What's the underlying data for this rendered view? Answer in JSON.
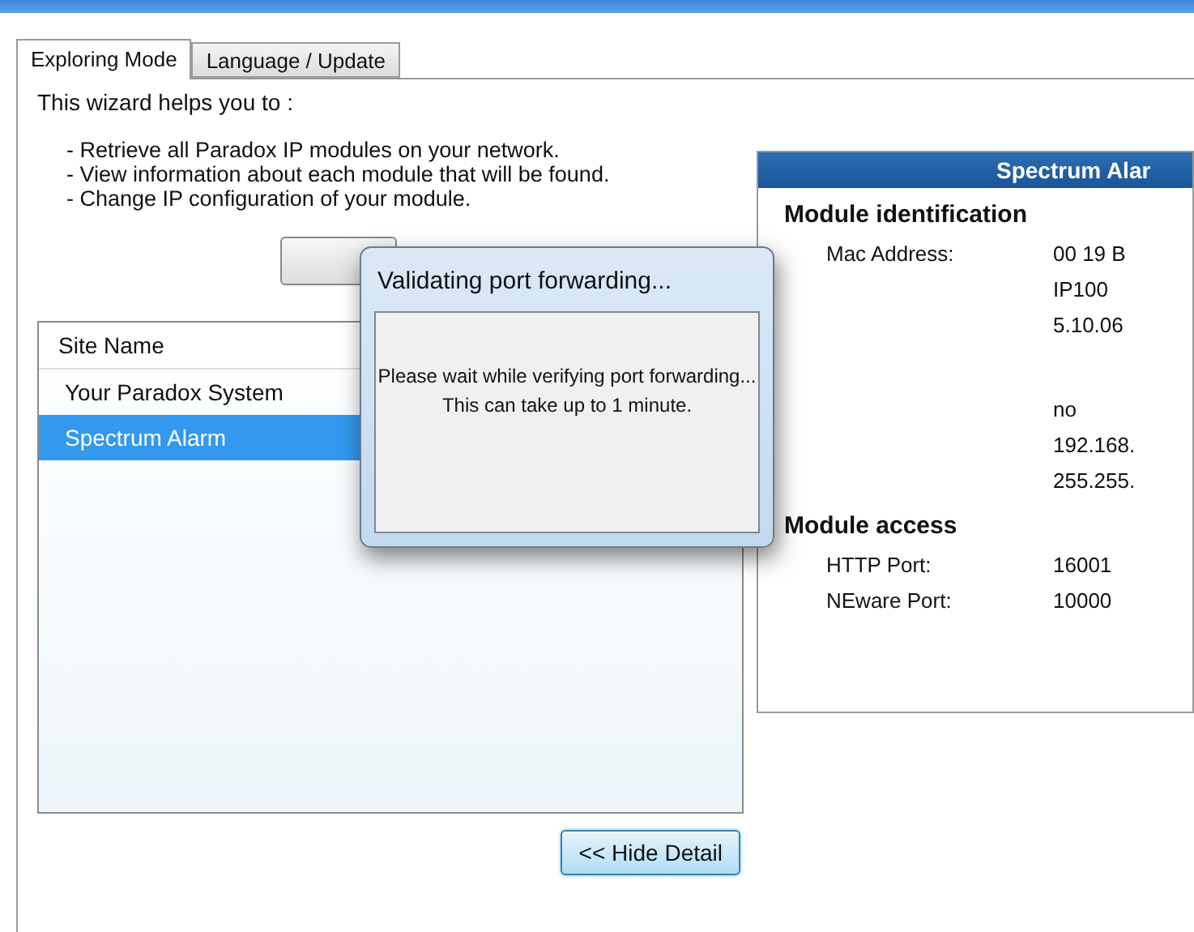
{
  "tabs": [
    {
      "label": "Exploring Mode",
      "selected": true
    },
    {
      "label": "Language / Update",
      "selected": false
    }
  ],
  "intro": {
    "heading": "This wizard helps you to :",
    "bullets": [
      "- Retrieve all Paradox IP modules on your network.",
      "- View information about each module that will be found.",
      "- Change IP configuration of your module."
    ]
  },
  "site_list": {
    "column": "Site Name",
    "rows": [
      {
        "name": "Your Paradox System",
        "selected": false
      },
      {
        "name": "Spectrum Alarm",
        "selected": true
      }
    ]
  },
  "hide_detail_button": "<< Hide Detail",
  "detail": {
    "title": "Spectrum Alar",
    "sections": [
      {
        "title": "Module identification",
        "rows": [
          {
            "label": "Mac Address:",
            "value": "00 19 B"
          },
          {
            "value": "IP100"
          },
          {
            "value": "5.10.06"
          }
        ]
      },
      {
        "rows": [
          {
            "value": "no"
          },
          {
            "value": "192.168."
          },
          {
            "value": "255.255."
          }
        ]
      },
      {
        "title": "Module access",
        "rows": [
          {
            "label": "HTTP Port:",
            "value": "16001"
          },
          {
            "label": "NEware Port:",
            "value": "10000"
          }
        ]
      }
    ]
  },
  "dialog": {
    "title": "Validating port forwarding...",
    "lines": [
      "Please wait while verifying port forwarding...",
      "This can take up to 1 minute."
    ]
  }
}
